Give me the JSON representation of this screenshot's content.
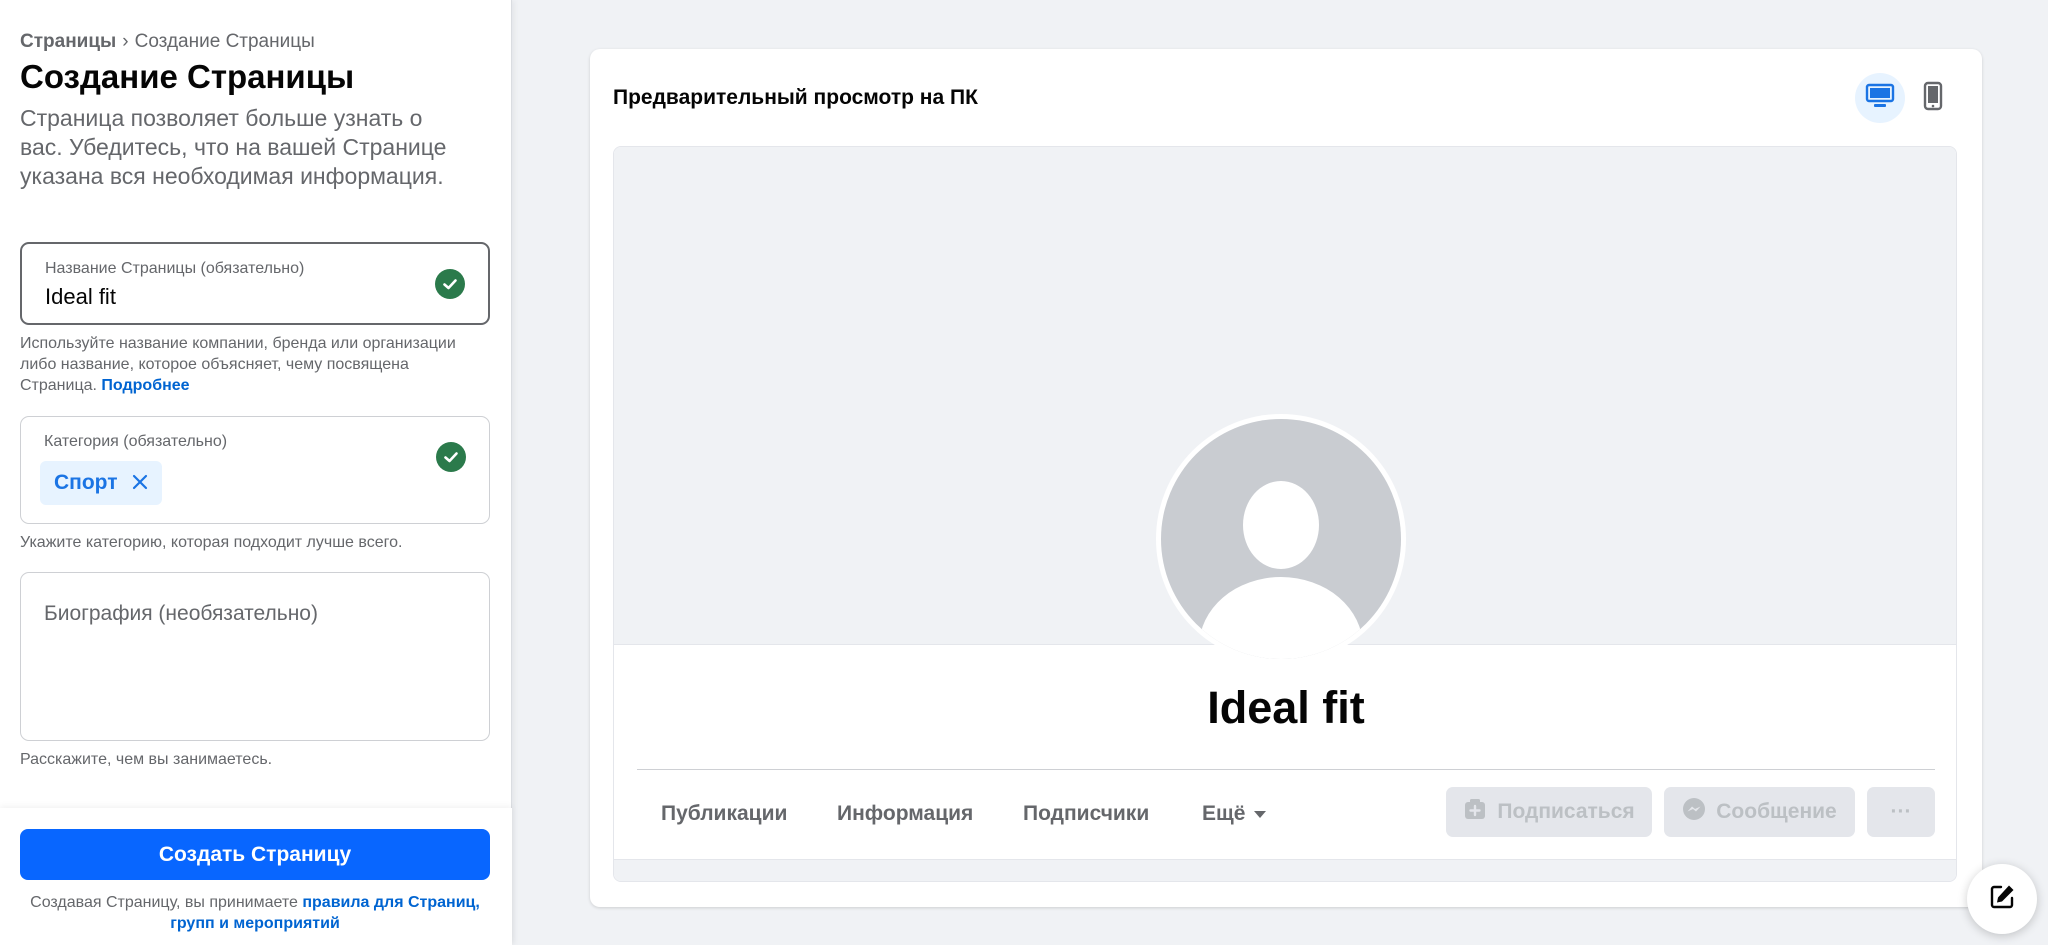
{
  "breadcrumb": {
    "root": "Страницы",
    "separator": "›",
    "current": "Создание Страницы"
  },
  "header": {
    "title": "Создание Страницы",
    "description": "Страница позволяет больше узнать о вас. Убедитесь, что на вашей Странице указана вся необходимая информация."
  },
  "form": {
    "name_field": {
      "label": "Название Страницы (обязательно)",
      "value": "Ideal fit",
      "status_icon": "check-circle-icon"
    },
    "name_help": "Используйте название компании, бренда или организации либо название, которое объясняет, чему посвящена Страница.",
    "name_help_link": "Подробнее",
    "category_field": {
      "label": "Категория (обязательно)",
      "chip": "Спорт",
      "remove_icon": "close-icon",
      "status_icon": "check-circle-icon"
    },
    "category_help": "Укажите категорию, которая подходит лучше всего.",
    "bio_field": {
      "placeholder": "Биография (необязательно)",
      "value": ""
    },
    "bio_help": "Расскажите, чем вы занимаетесь."
  },
  "footer": {
    "create_button": "Создать Страницу",
    "terms_text": "Создавая Страницу, вы принимаете ",
    "terms_link": "правила для Страниц, групп и мероприятий"
  },
  "preview": {
    "title": "Предварительный просмотр на ПК",
    "device_buttons": [
      {
        "icon": "desktop-icon",
        "active": true
      },
      {
        "icon": "mobile-icon",
        "active": false
      }
    ],
    "page_name": "Ideal fit",
    "tabs": [
      "Публикации",
      "Информация",
      "Подписчики",
      "Ещё"
    ],
    "actions": {
      "follow": "Подписаться",
      "message": "Сообщение",
      "more": "···"
    }
  },
  "colors": {
    "primary": "#0866ff",
    "link": "#0064d1",
    "success": "#2b7a4b",
    "chip_bg": "#e7f3ff",
    "background": "#f0f2f5"
  }
}
